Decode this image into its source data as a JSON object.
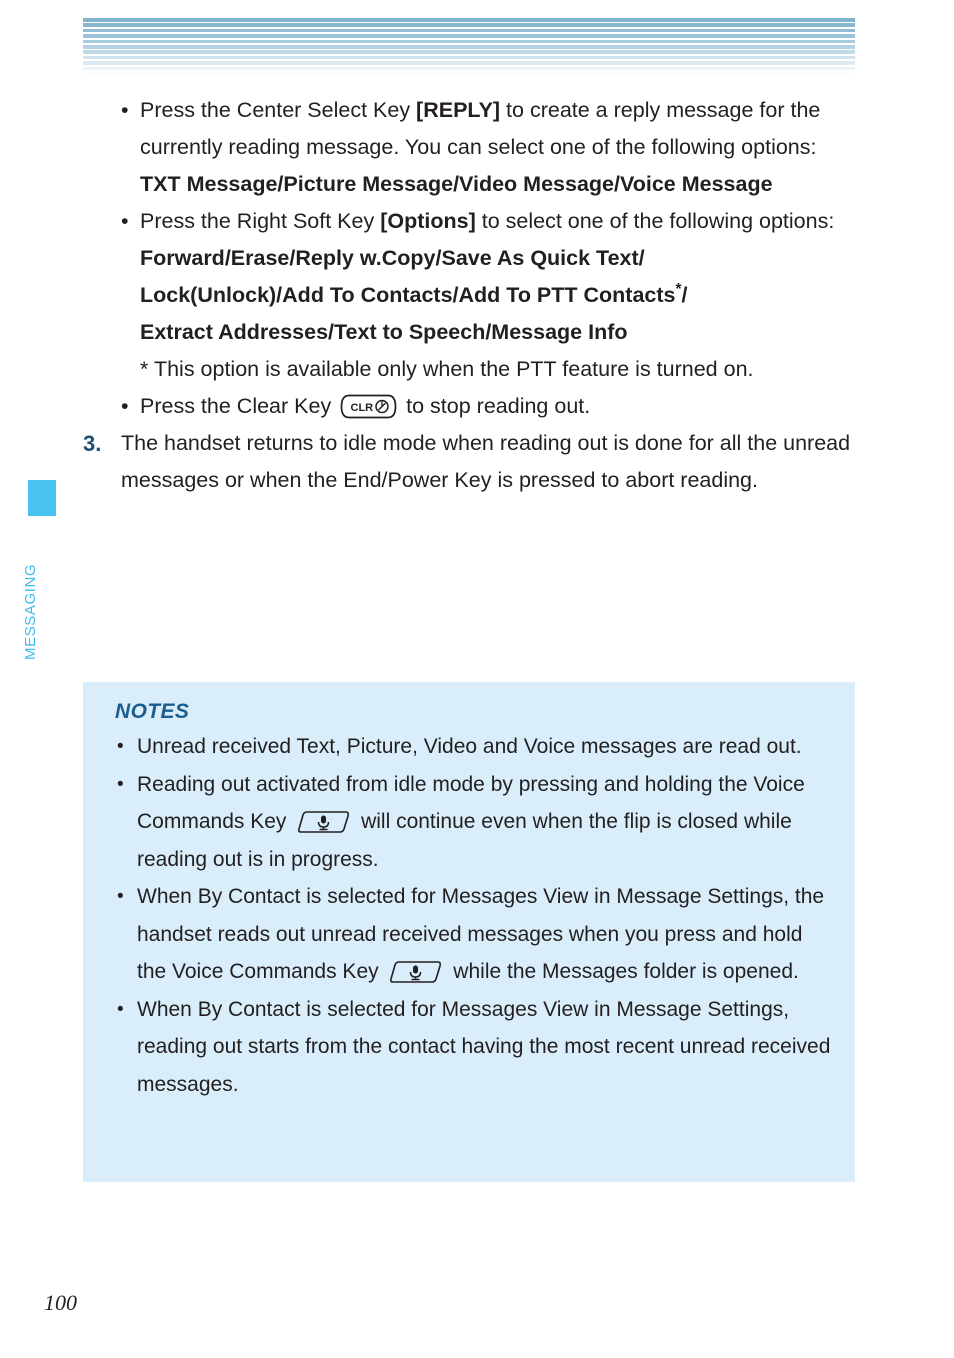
{
  "page": {
    "number": "100",
    "section_label": "MESSAGING",
    "accent_color": "#4AC3F0",
    "heading_color": "#1B5E8E",
    "notes_bg_color": "#d9eefa",
    "header_stripe_top_color": "#7FB3CE"
  },
  "body": {
    "bullet1": {
      "dot": "•",
      "part1": "Press the Center Select Key ",
      "key_label": "[REPLY]",
      "part2": " to create a reply message for the currently reading message. You can select one of the following options:",
      "options_bold": "TXT Message/Picture Message/Video Message/Voice Message"
    },
    "bullet2": {
      "dot": "•",
      "part1": "Press the Right Soft Key ",
      "key_label": "[Options]",
      "part2": " to select one of the following options:",
      "options_bold_line1": "Forward/Erase/Reply w.Copy/Save As Quick Text/",
      "options_bold_line2a": "Lock(Unlock)/Add To Contacts/Add To PTT Contacts",
      "options_bold_line2_star": "*",
      "options_bold_line2b": "/",
      "options_bold_line3": "Extract Addresses/Text to Speech/Message Info",
      "footnote": "* This option is available only when the PTT feature is turned on."
    },
    "bullet3": {
      "dot": "•",
      "part1": "Press the Clear Key ",
      "key_icon_name": "clear-key-icon",
      "key_icon_text": "CLR",
      "part2": " to stop reading out."
    },
    "step3": {
      "number": "3.",
      "text": "The handset returns to idle mode when reading out is done for all the unread messages or when the End/Power Key is pressed to abort reading."
    }
  },
  "notes": {
    "title": "NOTES",
    "items": [
      {
        "dot": "•",
        "text": "Unread received Text, Picture, Video and Voice messages are read out."
      },
      {
        "dot": "•",
        "part1": "Reading out activated from idle mode by pressing and holding the Voice Commands Key ",
        "key_icon_name": "voice-commands-key-icon",
        "part2": " will continue even when the flip is closed while reading out is in progress."
      },
      {
        "dot": "•",
        "part1": "When By Contact is selected for Messages View in Message Settings, the handset reads out unread received messages when you press and hold the Voice Commands Key ",
        "key_icon_name": "voice-commands-key-icon",
        "part2": " while the Messages folder is opened."
      },
      {
        "dot": "•",
        "text": "When By Contact is selected for Messages View in Message Settings, reading out starts from the contact having the most recent unread received messages."
      }
    ]
  }
}
